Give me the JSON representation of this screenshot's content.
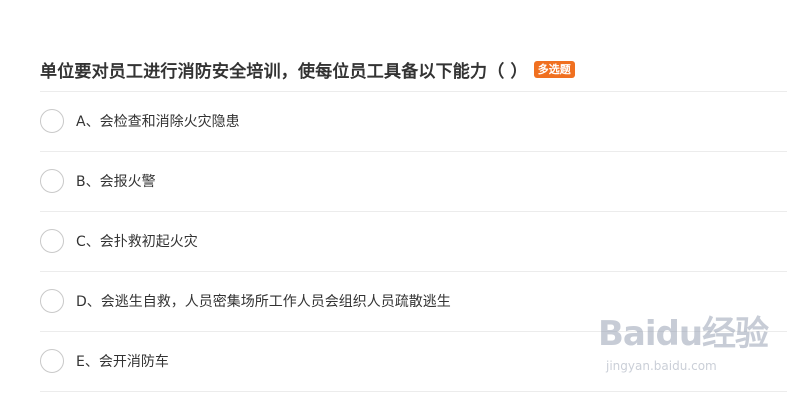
{
  "question": {
    "text": "单位要对员工进行消防安全培训，使每位员工具备以下能力（  ）",
    "type_badge": "多选题"
  },
  "options": [
    {
      "label": "A、会检查和消除火灾隐患"
    },
    {
      "label": "B、会报火警"
    },
    {
      "label": "C、会扑救初起火灾"
    },
    {
      "label": "D、会逃生自救，人员密集场所工作人员会组织人员疏散逃生"
    },
    {
      "label": "E、会开消防车"
    }
  ],
  "watermark": {
    "logo_text": "Baidu经验",
    "url": "jingyan.baidu.com"
  }
}
